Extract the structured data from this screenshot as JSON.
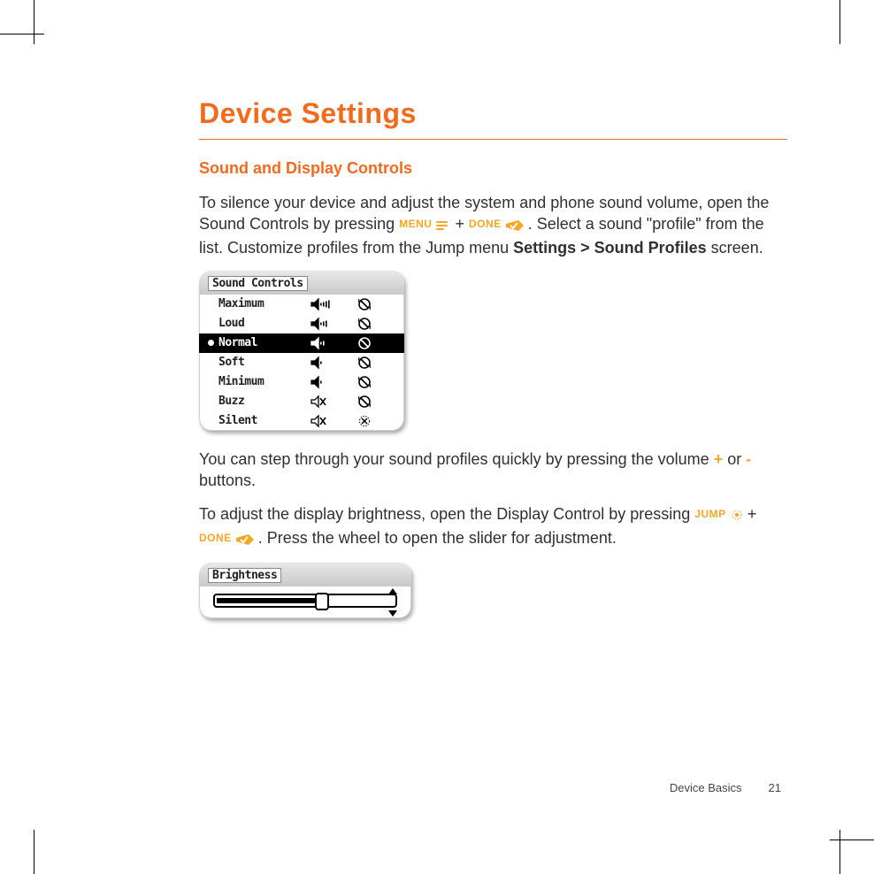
{
  "heading": "Device Settings",
  "subheading": "Sound and Display Controls",
  "para1": {
    "t1": "To silence your device and adjust the system and phone sound volume, open the Sound Controls by pressing ",
    "menu": "MENU",
    "plus1": " + ",
    "done": "DONE",
    "t2": ". Select a sound \"profile\" from the list. Customize profiles from the Jump menu ",
    "bold": "Settings > Sound Profiles",
    "t3": " screen."
  },
  "sound_widget": {
    "title": "Sound Controls",
    "rows": [
      {
        "label": "Maximum",
        "bars": 4,
        "muted": false,
        "vibrate": true,
        "selected": false
      },
      {
        "label": "Loud",
        "bars": 3,
        "muted": false,
        "vibrate": true,
        "selected": false
      },
      {
        "label": "Normal",
        "bars": 2,
        "muted": false,
        "vibrate": false,
        "selected": true,
        "sel_vibrate_off": true
      },
      {
        "label": "Soft",
        "bars": 1,
        "muted": false,
        "vibrate": true,
        "selected": false
      },
      {
        "label": "Minimum",
        "bars": 1,
        "muted": false,
        "vibrate": true,
        "selected": false,
        "tiny": true
      },
      {
        "label": "Buzz",
        "bars": 0,
        "muted": true,
        "vibrate": true,
        "selected": false
      },
      {
        "label": "Silent",
        "bars": 0,
        "muted": true,
        "vibrate": false,
        "selected": false,
        "vib_off_x": true
      }
    ]
  },
  "para2": {
    "t1": "You can step through your sound profiles quickly by pressing the volume ",
    "plus_key": "+",
    "t2": " or ",
    "minus_key": "-",
    "t3": " buttons."
  },
  "para3": {
    "t1": "To adjust the display brightness, open the Display Control by pressing ",
    "jump": "JUMP",
    "plus1": " + ",
    "done": "DONE",
    "t2": ". Press the wheel to open the slider for adjustment."
  },
  "brightness_widget": {
    "title": "Brightness",
    "value_percent": 58
  },
  "footer": {
    "section": "Device Basics",
    "page": "21"
  }
}
